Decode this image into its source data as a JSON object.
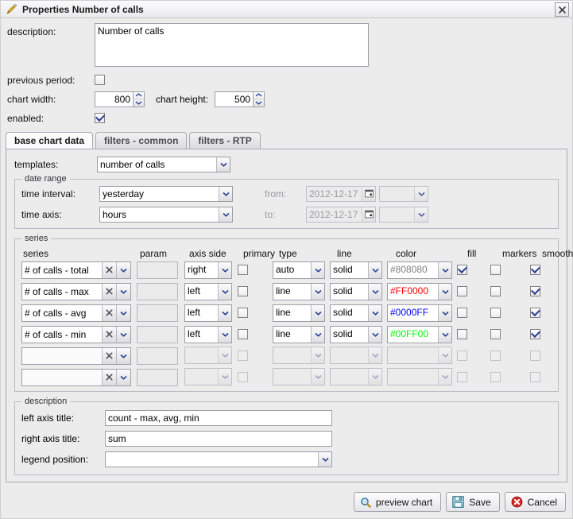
{
  "window": {
    "title": "Properties Number of calls",
    "title_icon": "pencil-icon",
    "close_icon": "close-icon"
  },
  "form": {
    "description_label": "description:",
    "description_value": "Number of calls",
    "previous_period_label": "previous period:",
    "previous_period_checked": false,
    "chart_width_label": "chart width:",
    "chart_width_value": "800",
    "chart_height_label": "chart height:",
    "chart_height_value": "500",
    "enabled_label": "enabled:",
    "enabled_checked": true
  },
  "tabs": [
    {
      "label": "base chart data",
      "active": true
    },
    {
      "label": "filters - common",
      "active": false
    },
    {
      "label": "filters - RTP",
      "active": false
    }
  ],
  "templates": {
    "label": "templates:",
    "value": "number of calls"
  },
  "date_range": {
    "legend": "date range",
    "time_interval_label": "time interval:",
    "time_interval_value": "yesterday",
    "time_axis_label": "time axis:",
    "time_axis_value": "hours",
    "from_label": "from:",
    "from_value": "2012-12-17",
    "from_time_value": "",
    "to_label": "to:",
    "to_value": "2012-12-17",
    "to_time_value": "",
    "calendar_icon": "calendar-icon"
  },
  "series_panel": {
    "legend": "series",
    "columns": [
      "series",
      "param",
      "axis side",
      "primary",
      "type",
      "line",
      "color",
      "fill",
      "markers",
      "smooth"
    ],
    "rows": [
      {
        "series": "# of calls - total",
        "param": "",
        "axis_side": "right",
        "primary": false,
        "type": "auto",
        "line": "solid",
        "color": "#808080",
        "fill": true,
        "markers": false,
        "smooth": true,
        "enabled": true
      },
      {
        "series": "# of calls - max",
        "param": "",
        "axis_side": "left",
        "primary": false,
        "type": "line",
        "line": "solid",
        "color": "#FF0000",
        "fill": false,
        "markers": false,
        "smooth": true,
        "enabled": true
      },
      {
        "series": "# of calls - avg",
        "param": "",
        "axis_side": "left",
        "primary": false,
        "type": "line",
        "line": "solid",
        "color": "#0000FF",
        "fill": false,
        "markers": false,
        "smooth": true,
        "enabled": true
      },
      {
        "series": "# of calls - min",
        "param": "",
        "axis_side": "left",
        "primary": false,
        "type": "line",
        "line": "solid",
        "color": "#00FF00",
        "fill": false,
        "markers": false,
        "smooth": true,
        "enabled": true
      },
      {
        "series": "",
        "param": "",
        "axis_side": "",
        "primary": false,
        "type": "",
        "line": "",
        "color": "",
        "fill": false,
        "markers": false,
        "smooth": false,
        "enabled": false
      },
      {
        "series": "",
        "param": "",
        "axis_side": "",
        "primary": false,
        "type": "",
        "line": "",
        "color": "",
        "fill": false,
        "markers": false,
        "smooth": false,
        "enabled": false
      }
    ],
    "clear_icon": "clear-x-icon",
    "dropdown_icon": "chevron-down-icon"
  },
  "description_panel": {
    "legend": "description",
    "left_axis_title_label": "left axis title:",
    "left_axis_title_value": "count - max, avg, min",
    "right_axis_title_label": "right axis title:",
    "right_axis_title_value": "sum",
    "legend_position_label": "legend position:",
    "legend_position_value": ""
  },
  "footer": {
    "preview_label": "preview chart",
    "preview_icon": "magnifier-icon",
    "save_label": "Save",
    "save_icon": "floppy-disk-icon",
    "cancel_label": "Cancel",
    "cancel_icon": "cancel-circle-icon"
  }
}
